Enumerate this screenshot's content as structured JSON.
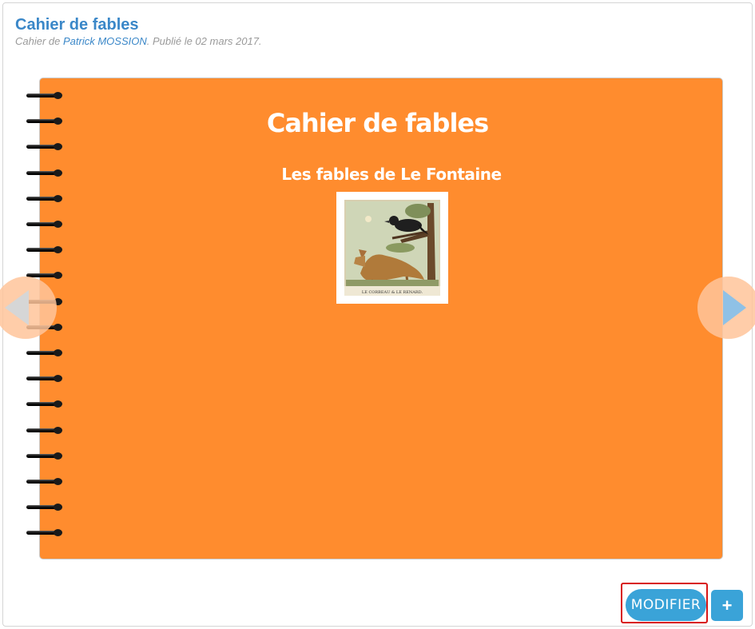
{
  "header": {
    "title": "Cahier de fables",
    "subtitle_prefix": "Cahier de ",
    "author": "Patrick MOSSION",
    "subtitle_suffix": ". Publié le 02 mars 2017."
  },
  "book": {
    "title": "Cahier de fables",
    "subtitle": "Les fables de Le Fontaine",
    "image_caption": "LE CORBEAU & LE RENARD.",
    "cover_color": "#ff8c2e"
  },
  "navigation": {
    "prev_icon": "triangle-left-icon",
    "next_icon": "triangle-right-icon"
  },
  "actions": {
    "modify_label": "MODIFIER",
    "add_label": "+",
    "accent": "#3aa3d8"
  }
}
